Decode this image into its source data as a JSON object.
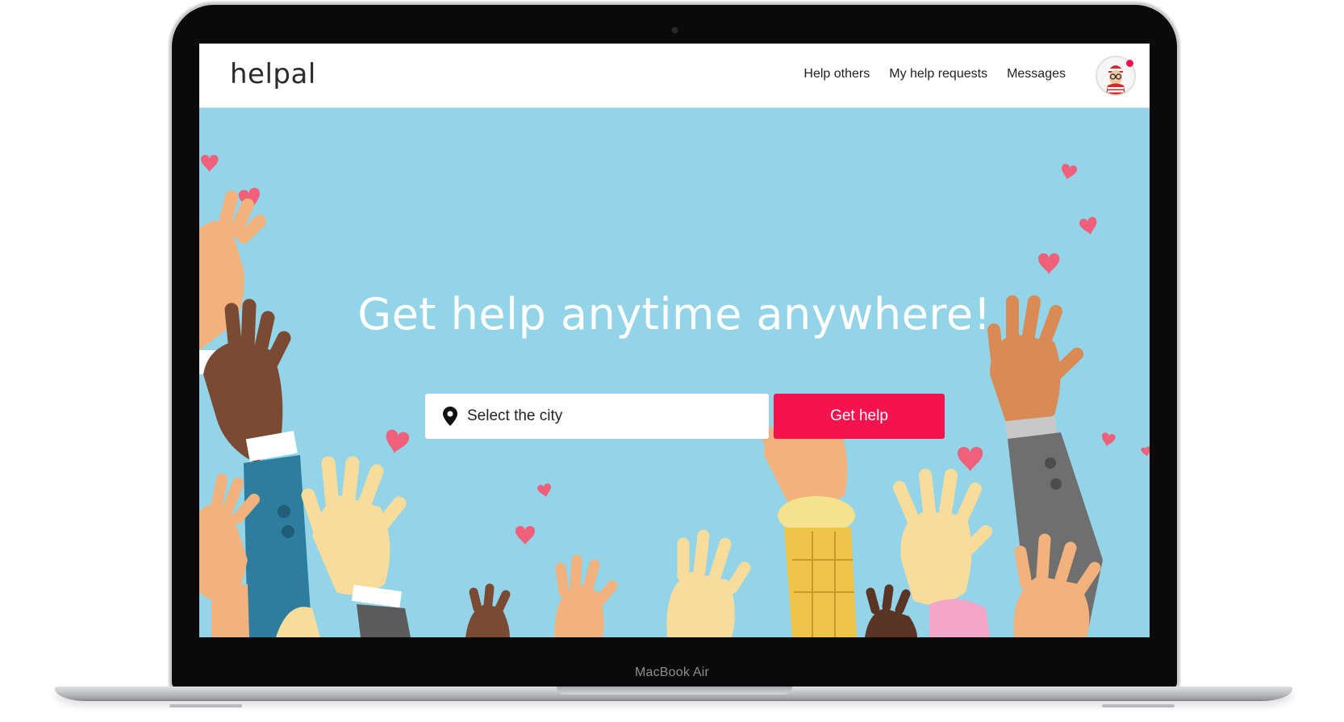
{
  "laptop": {
    "model_label": "MacBook Air"
  },
  "navbar": {
    "logo": "helpal",
    "links": [
      {
        "label": "Help others"
      },
      {
        "label": "My help requests"
      },
      {
        "label": "Messages"
      }
    ],
    "notification_color": "#f4134f"
  },
  "hero": {
    "title": "Get help anytime anywhere!",
    "city_placeholder": "Select the city",
    "cta_label": "Get help",
    "background_color": "#93d4e8",
    "accent_color": "#f4134f",
    "heart_color": "#f0607a"
  }
}
